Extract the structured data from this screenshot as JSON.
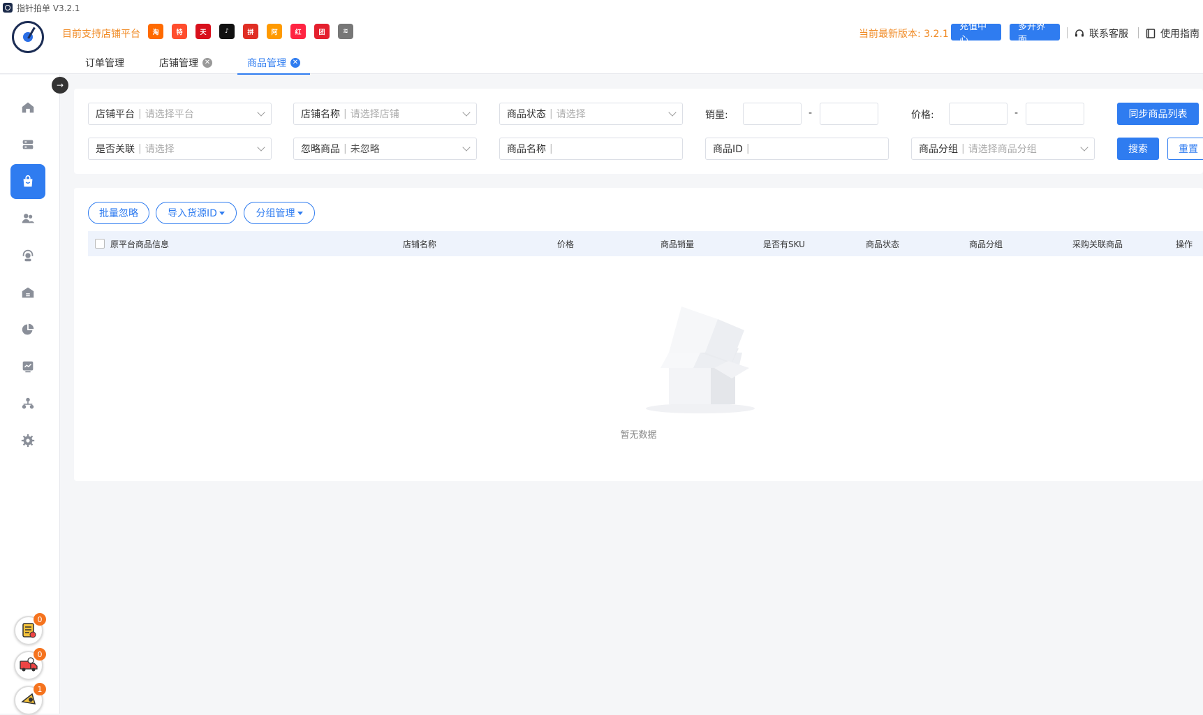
{
  "window": {
    "title": "指针拍单 V3.2.1"
  },
  "header": {
    "platform_label": "目前支持店铺平台",
    "platforms": [
      {
        "name": "taobao",
        "glyph": "淘",
        "color": "#ff6a00"
      },
      {
        "name": "tejia",
        "glyph": "特",
        "color": "#ff4d2d"
      },
      {
        "name": "tmall",
        "glyph": "天",
        "color": "#d8101c"
      },
      {
        "name": "douyin",
        "glyph": "♪",
        "color": "#111111"
      },
      {
        "name": "pinduoduo",
        "glyph": "拼",
        "color": "#e02e24"
      },
      {
        "name": "1688",
        "glyph": "阿",
        "color": "#ff9a00"
      },
      {
        "name": "xiaohongshu",
        "glyph": "红",
        "color": "#ff2442"
      },
      {
        "name": "kuaituantuan",
        "glyph": "团",
        "color": "#e4202e"
      },
      {
        "name": "other",
        "glyph": "≋",
        "color": "#777777"
      }
    ],
    "latest_version": "当前最新版本: 3.2.1",
    "recharge_label": "充值中心",
    "multi_window_label": "多开界面",
    "support_label": "联系客服",
    "guide_label": "使用指南"
  },
  "tabs": [
    {
      "label": "订单管理",
      "closable": false,
      "active": false
    },
    {
      "label": "店铺管理",
      "closable": true,
      "active": false
    },
    {
      "label": "商品管理",
      "closable": true,
      "active": true
    }
  ],
  "sidebar": {
    "items": [
      {
        "icon": "home-icon"
      },
      {
        "icon": "store-icon"
      },
      {
        "icon": "shopping-bag-icon"
      },
      {
        "icon": "users-icon"
      },
      {
        "icon": "headset-icon"
      },
      {
        "icon": "warehouse-icon"
      },
      {
        "icon": "pie-chart-icon"
      },
      {
        "icon": "trend-chart-icon"
      },
      {
        "icon": "org-tree-icon"
      },
      {
        "icon": "settings-icon"
      }
    ],
    "float_buttons": [
      {
        "icon": "task-list-icon",
        "badge": "0"
      },
      {
        "icon": "delivery-truck-icon",
        "badge": "0"
      },
      {
        "icon": "announcement-icon",
        "badge": "1"
      }
    ]
  },
  "filters": {
    "store_platform": {
      "label": "店铺平台",
      "placeholder": "请选择平台"
    },
    "store_name": {
      "label": "店铺名称",
      "placeholder": "请选择店铺"
    },
    "product_status": {
      "label": "商品状态",
      "placeholder": "请选择"
    },
    "sales_label": "销量:",
    "price_label": "价格:",
    "range_dash": "-",
    "sync_button": "同步商品列表",
    "is_linked": {
      "label": "是否关联",
      "placeholder": "请选择"
    },
    "ignore_product": {
      "label": "忽略商品",
      "value": "未忽略"
    },
    "product_name": {
      "label": "商品名称"
    },
    "product_id": {
      "label": "商品ID"
    },
    "product_group": {
      "label": "商品分组",
      "placeholder": "请选择商品分组"
    },
    "search_button": "搜索",
    "reset_button": "重置"
  },
  "table": {
    "actions": {
      "batch_ignore": "批量忽略",
      "import_source_id": "导入货源ID",
      "group_manage": "分组管理"
    },
    "columns": [
      "原平台商品信息",
      "店铺名称",
      "价格",
      "商品销量",
      "是否有SKU",
      "商品状态",
      "商品分组",
      "采购关联商品",
      "操作"
    ],
    "empty_text": "暂无数据"
  },
  "colors": {
    "primary": "#2f7cf0",
    "accent_orange": "#f08a24",
    "badge": "#f5731e"
  }
}
